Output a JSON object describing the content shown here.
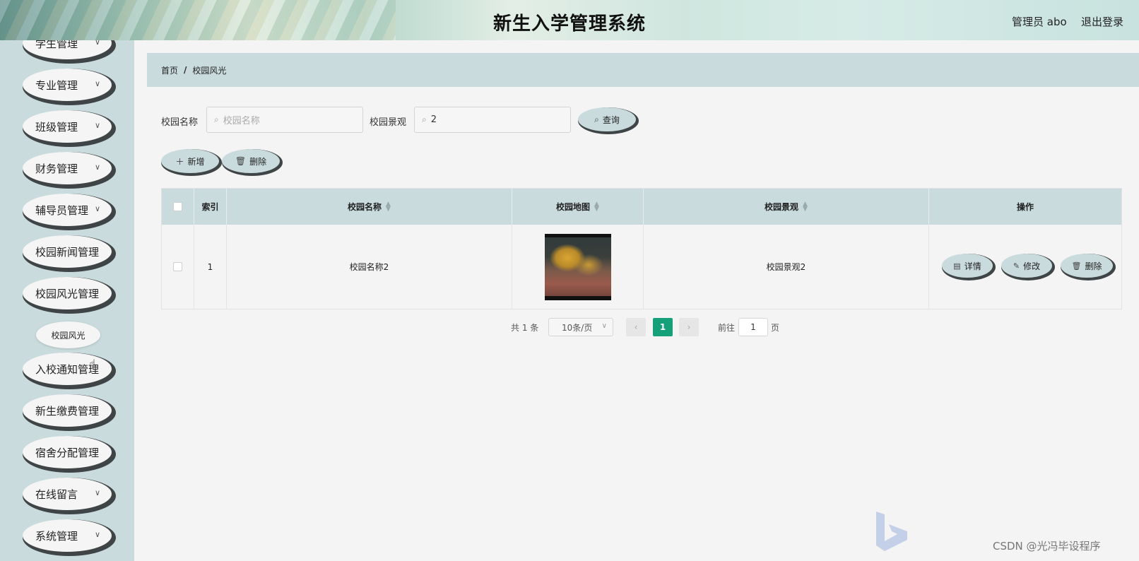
{
  "header": {
    "title": "新生入学管理系统",
    "user": "管理员 abo",
    "logout": "退出登录"
  },
  "sidebar": {
    "items": [
      {
        "label": "学生管理",
        "chevron": true
      },
      {
        "label": "专业管理",
        "chevron": true
      },
      {
        "label": "班级管理",
        "chevron": true
      },
      {
        "label": "财务管理",
        "chevron": true
      },
      {
        "label": "辅导员管理",
        "chevron": true
      },
      {
        "label": "校园新闻管理",
        "chevron": false
      },
      {
        "label": "校园风光管理",
        "chevron": false
      },
      {
        "label": "入校通知管理",
        "chevron": false
      },
      {
        "label": "新生缴费管理",
        "chevron": false
      },
      {
        "label": "宿舍分配管理",
        "chevron": false
      },
      {
        "label": "在线留言",
        "chevron": true
      },
      {
        "label": "系统管理",
        "chevron": true
      }
    ],
    "submenu": "校园风光"
  },
  "breadcrumb": {
    "home": "首页",
    "sep": "/",
    "current": "校园风光"
  },
  "search": {
    "name_label": "校园名称",
    "name_placeholder": "校园名称",
    "name_value": "",
    "scene_label": "校园景观",
    "scene_value": "2",
    "query_button": "查询"
  },
  "actions": {
    "add": "新增",
    "delete": "删除"
  },
  "table": {
    "headers": {
      "index": "索引",
      "name": "校园名称",
      "map": "校园地图",
      "scene": "校园景观",
      "ops": "操作"
    },
    "rows": [
      {
        "index": "1",
        "name": "校园名称2",
        "scene": "校园景观2",
        "detail": "详情",
        "edit": "修改",
        "delete": "删除"
      }
    ]
  },
  "pagination": {
    "total": "共 1 条",
    "page_size": "10条/页",
    "current": "1",
    "goto_prefix": "前往",
    "goto_value": "1",
    "goto_suffix": "页"
  },
  "watermark": "CSDN @光冯毕设程序"
}
